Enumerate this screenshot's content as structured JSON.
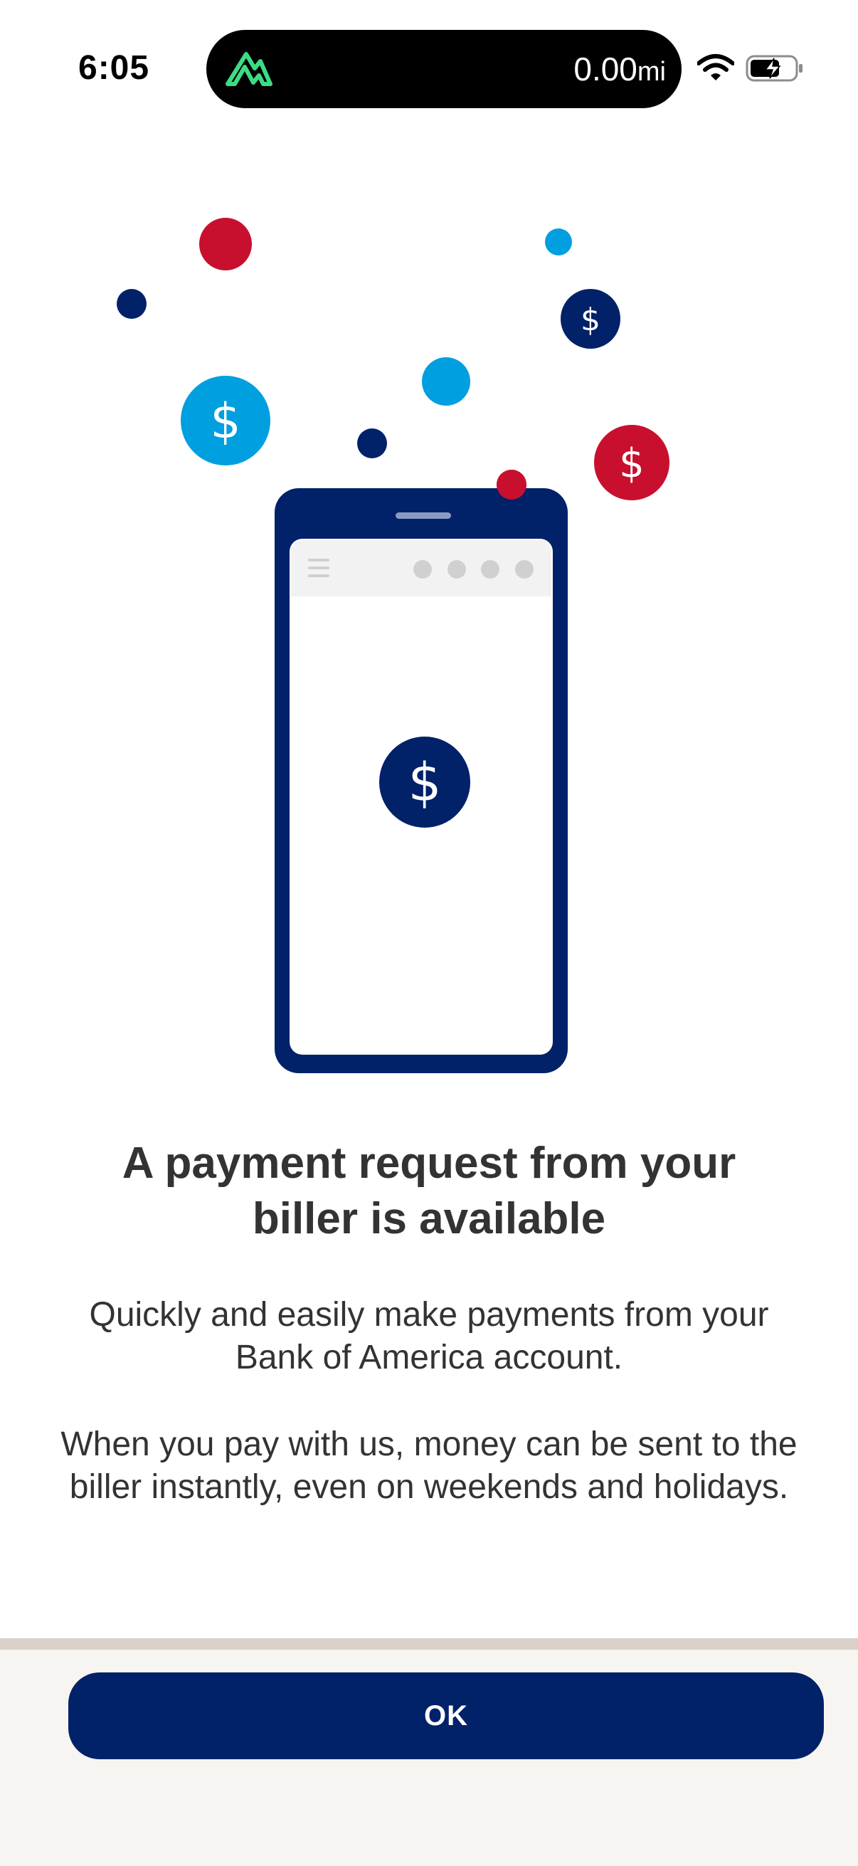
{
  "status_bar": {
    "time": "6:05",
    "distance_value": "0.00",
    "distance_unit": "mi"
  },
  "icons": {
    "activity": "mountain-logo-icon",
    "wifi": "wifi-icon",
    "battery": "battery-charging-icon",
    "currency": "dollar-icon",
    "menu": "hamburger-menu-icon"
  },
  "colors": {
    "navy": "#012169",
    "red": "#C8102E",
    "blue": "#009FDF",
    "footer_bg": "#F7F5F2"
  },
  "content": {
    "headline": "A payment request from your biller is available",
    "paragraph_1": "Quickly and easily make payments from your Bank of America account.",
    "paragraph_2": "When you pay with us, money can be sent to the biller instantly, even on weekends and holidays."
  },
  "actions": {
    "ok_label": "OK"
  }
}
